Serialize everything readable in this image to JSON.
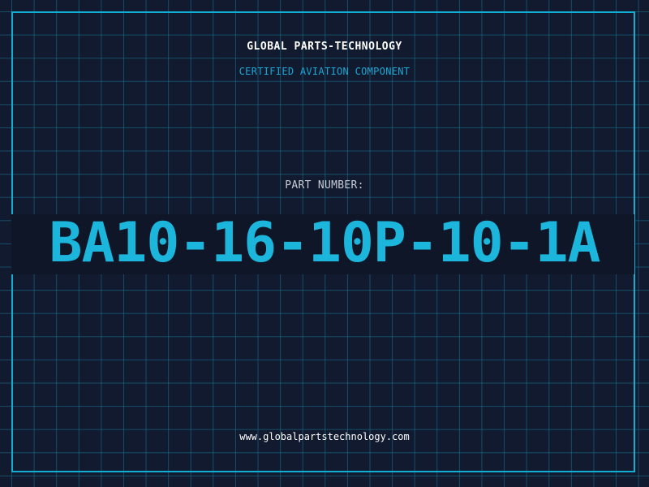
{
  "brand": {
    "name": "GLOBAL PARTS-TECHNOLOGY",
    "tagline": "CERTIFIED AVIATION COMPONENT"
  },
  "part": {
    "label": "PART NUMBER:",
    "number": "BA10-16-10P-10-1A"
  },
  "footer": {
    "website": "www.globalpartstechnology.com"
  },
  "colors": {
    "background": "#111a2f",
    "grid": "#18789a",
    "accent": "#13aed4",
    "text_primary": "#ffffff",
    "text_label": "#c6ccd6"
  }
}
